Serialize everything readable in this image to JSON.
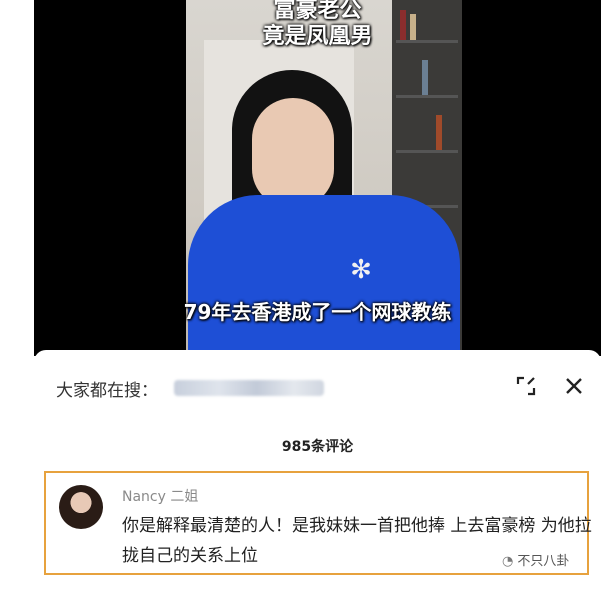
{
  "video": {
    "title_line1": "富豪老公",
    "title_line2": "竟是凤凰男",
    "subtitle": "79年去香港成了一个网球教练"
  },
  "search_bar": {
    "label": "大家都在搜："
  },
  "comments": {
    "count_label": "985条评论",
    "items": [
      {
        "username": "Nancy 二姐",
        "text": "你是解释最清楚的人！是我妹妹一首把他捧 上去富豪榜 为他拉拢自己的关系上位"
      }
    ]
  },
  "watermark": {
    "text": "不只八卦"
  },
  "colors": {
    "highlight_border": "#e7a23e",
    "jacket_blue": "#1e4fd6"
  }
}
